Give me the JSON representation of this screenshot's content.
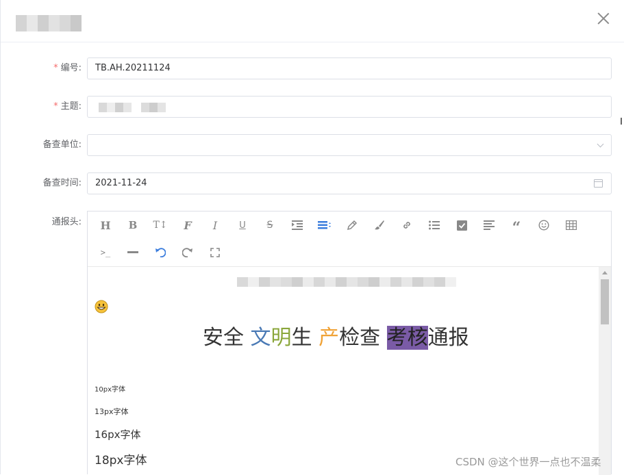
{
  "form": {
    "code": {
      "label": "编号:",
      "value": "TB.AH.20211124"
    },
    "subject": {
      "label": "主题:"
    },
    "unit": {
      "label": "备查单位:",
      "value": ""
    },
    "time": {
      "label": "备查时间:",
      "value": "2021-11-24"
    },
    "header": {
      "label": "通报头:"
    }
  },
  "toolbar": {
    "icons": [
      "heading-icon",
      "bold-icon",
      "text-size-icon",
      "font-icon",
      "italic-icon",
      "underline-icon",
      "strikethrough-icon",
      "indent-icon",
      "align-icon",
      "pen-icon",
      "brush-icon",
      "link-icon",
      "list-icon",
      "checkbox-icon",
      "justify-icon",
      "quote-icon",
      "emoji-icon",
      "table-icon",
      "code-icon",
      "hr-icon",
      "undo-icon",
      "redo-icon",
      "fullscreen-icon"
    ]
  },
  "content": {
    "headline": {
      "p1": "安全 ",
      "p2": "文",
      "p3": "明",
      "p4": "生 ",
      "p5": "产",
      "p6": "检查 ",
      "p7": "考核",
      "p8": "通报"
    },
    "sizes": {
      "s10": "10px字体",
      "s13": "13px字体",
      "s16": "16px字体",
      "s18": "18px字体"
    }
  },
  "watermark": "CSDN @这个世界一点也不温柔"
}
